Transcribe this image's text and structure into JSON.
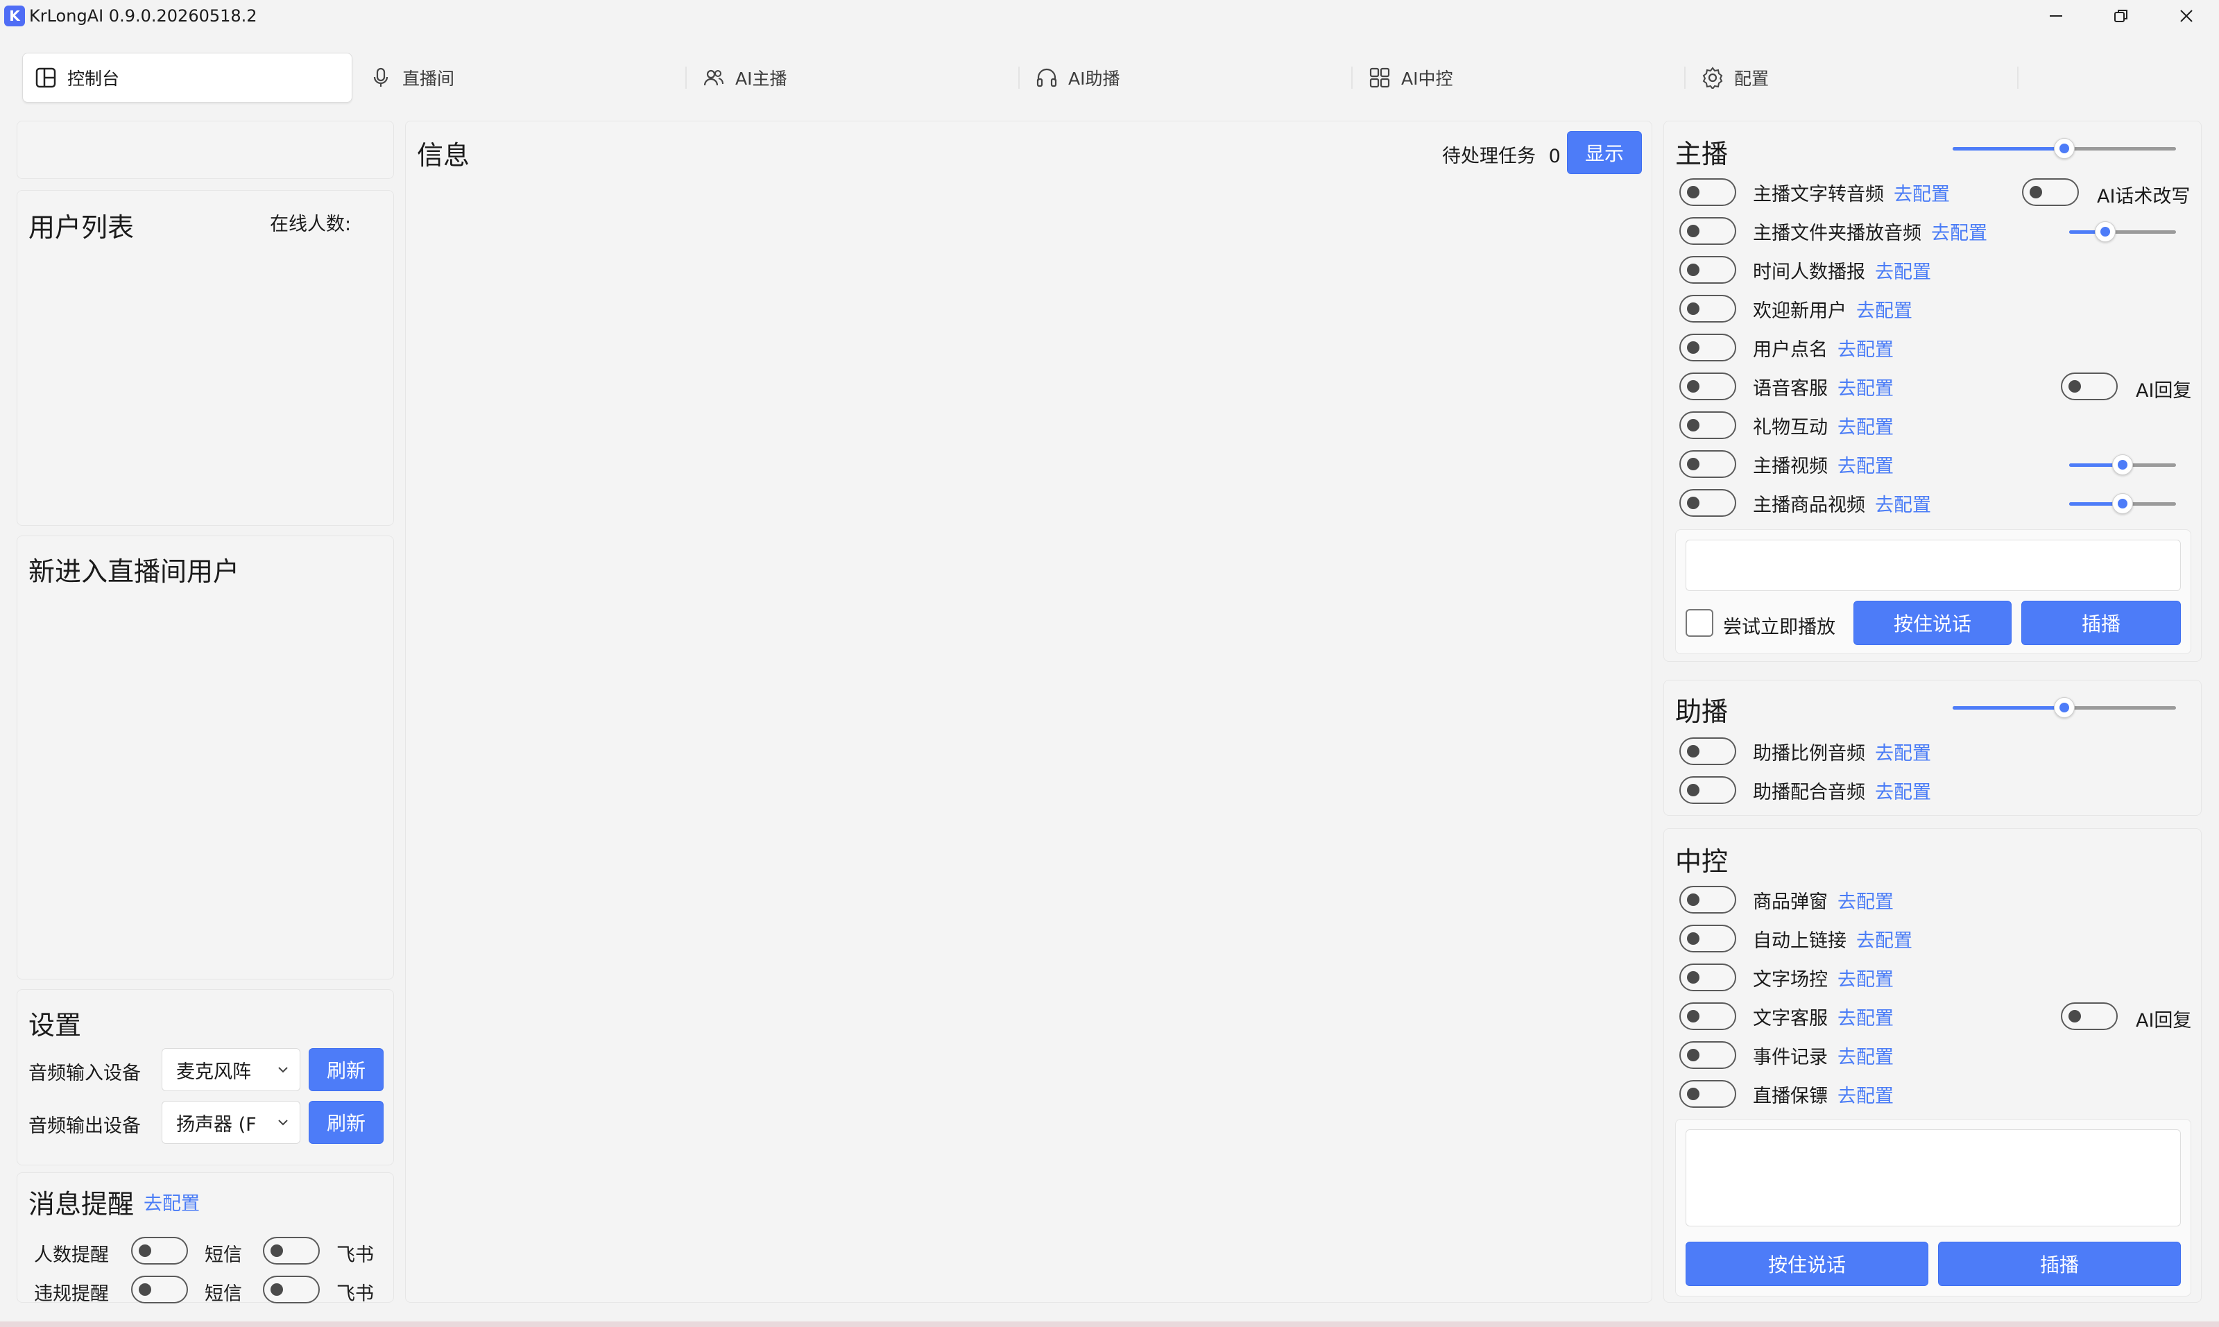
{
  "window": {
    "title": "KrLongAI 0.9.0.20260518.2",
    "logo": "K"
  },
  "icons": {
    "minimize": "minimize-icon",
    "restore": "restore-icon",
    "close": "close-icon"
  },
  "tabs": [
    {
      "label": "控制台",
      "icon": "dashboard-icon"
    },
    {
      "label": "直播间",
      "icon": "microphone-icon"
    },
    {
      "label": "AI主播",
      "icon": "users-icon"
    },
    {
      "label": "AI助播",
      "icon": "headphones-icon"
    },
    {
      "label": "AI中控",
      "icon": "grid-icon"
    },
    {
      "label": "配置",
      "icon": "gear-icon"
    }
  ],
  "user_list": {
    "title": "用户列表",
    "online_label": "在线人数:"
  },
  "new_users": {
    "title": "新进入直播间用户"
  },
  "settings": {
    "title": "设置",
    "audio_input_label": "音频输入设备",
    "audio_input_value": "麦克风阵",
    "audio_output_label": "音频输出设备",
    "audio_output_value": "扬声器 (F",
    "refresh_label": "刷新"
  },
  "notify": {
    "title": "消息提醒",
    "config_link": "去配置",
    "rows": [
      {
        "label": "人数提醒",
        "sms": "短信",
        "feishu": "飞书"
      },
      {
        "label": "违规提醒",
        "sms": "短信",
        "feishu": "飞书"
      }
    ]
  },
  "info": {
    "title": "信息",
    "pending_label": "待处理任务",
    "pending_count": "0",
    "show_button": "显示"
  },
  "host": {
    "title": "主播",
    "volume": 0.5,
    "config_link": "去配置",
    "items": [
      {
        "label": "主播文字转音频"
      },
      {
        "label": "主播文件夹播放音频"
      },
      {
        "label": "时间人数播报"
      },
      {
        "label": "欢迎新用户"
      },
      {
        "label": "用户点名"
      },
      {
        "label": "语音客服"
      },
      {
        "label": "礼物互动"
      },
      {
        "label": "主播视频"
      },
      {
        "label": "主播商品视频"
      }
    ],
    "ai_rewrite_label": "AI话术改写",
    "ai_reply_label": "AI回复",
    "folder_volume": 0.3,
    "video_volume": 0.5,
    "product_video_volume": 0.5,
    "try_play_label": "尝试立即播放",
    "hold_talk_label": "按住说话",
    "insert_label": "插播"
  },
  "assistant": {
    "title": "助播",
    "volume": 0.5,
    "config_link": "去配置",
    "items": [
      {
        "label": "助播比例音频"
      },
      {
        "label": "助播配合音频"
      }
    ]
  },
  "control": {
    "title": "中控",
    "config_link": "去配置",
    "items": [
      {
        "label": "商品弹窗"
      },
      {
        "label": "自动上链接"
      },
      {
        "label": "文字场控"
      },
      {
        "label": "文字客服"
      },
      {
        "label": "事件记录"
      },
      {
        "label": "直播保镖"
      }
    ],
    "ai_reply_label": "AI回复",
    "hold_talk_label": "按住说话",
    "insert_label": "插播"
  }
}
